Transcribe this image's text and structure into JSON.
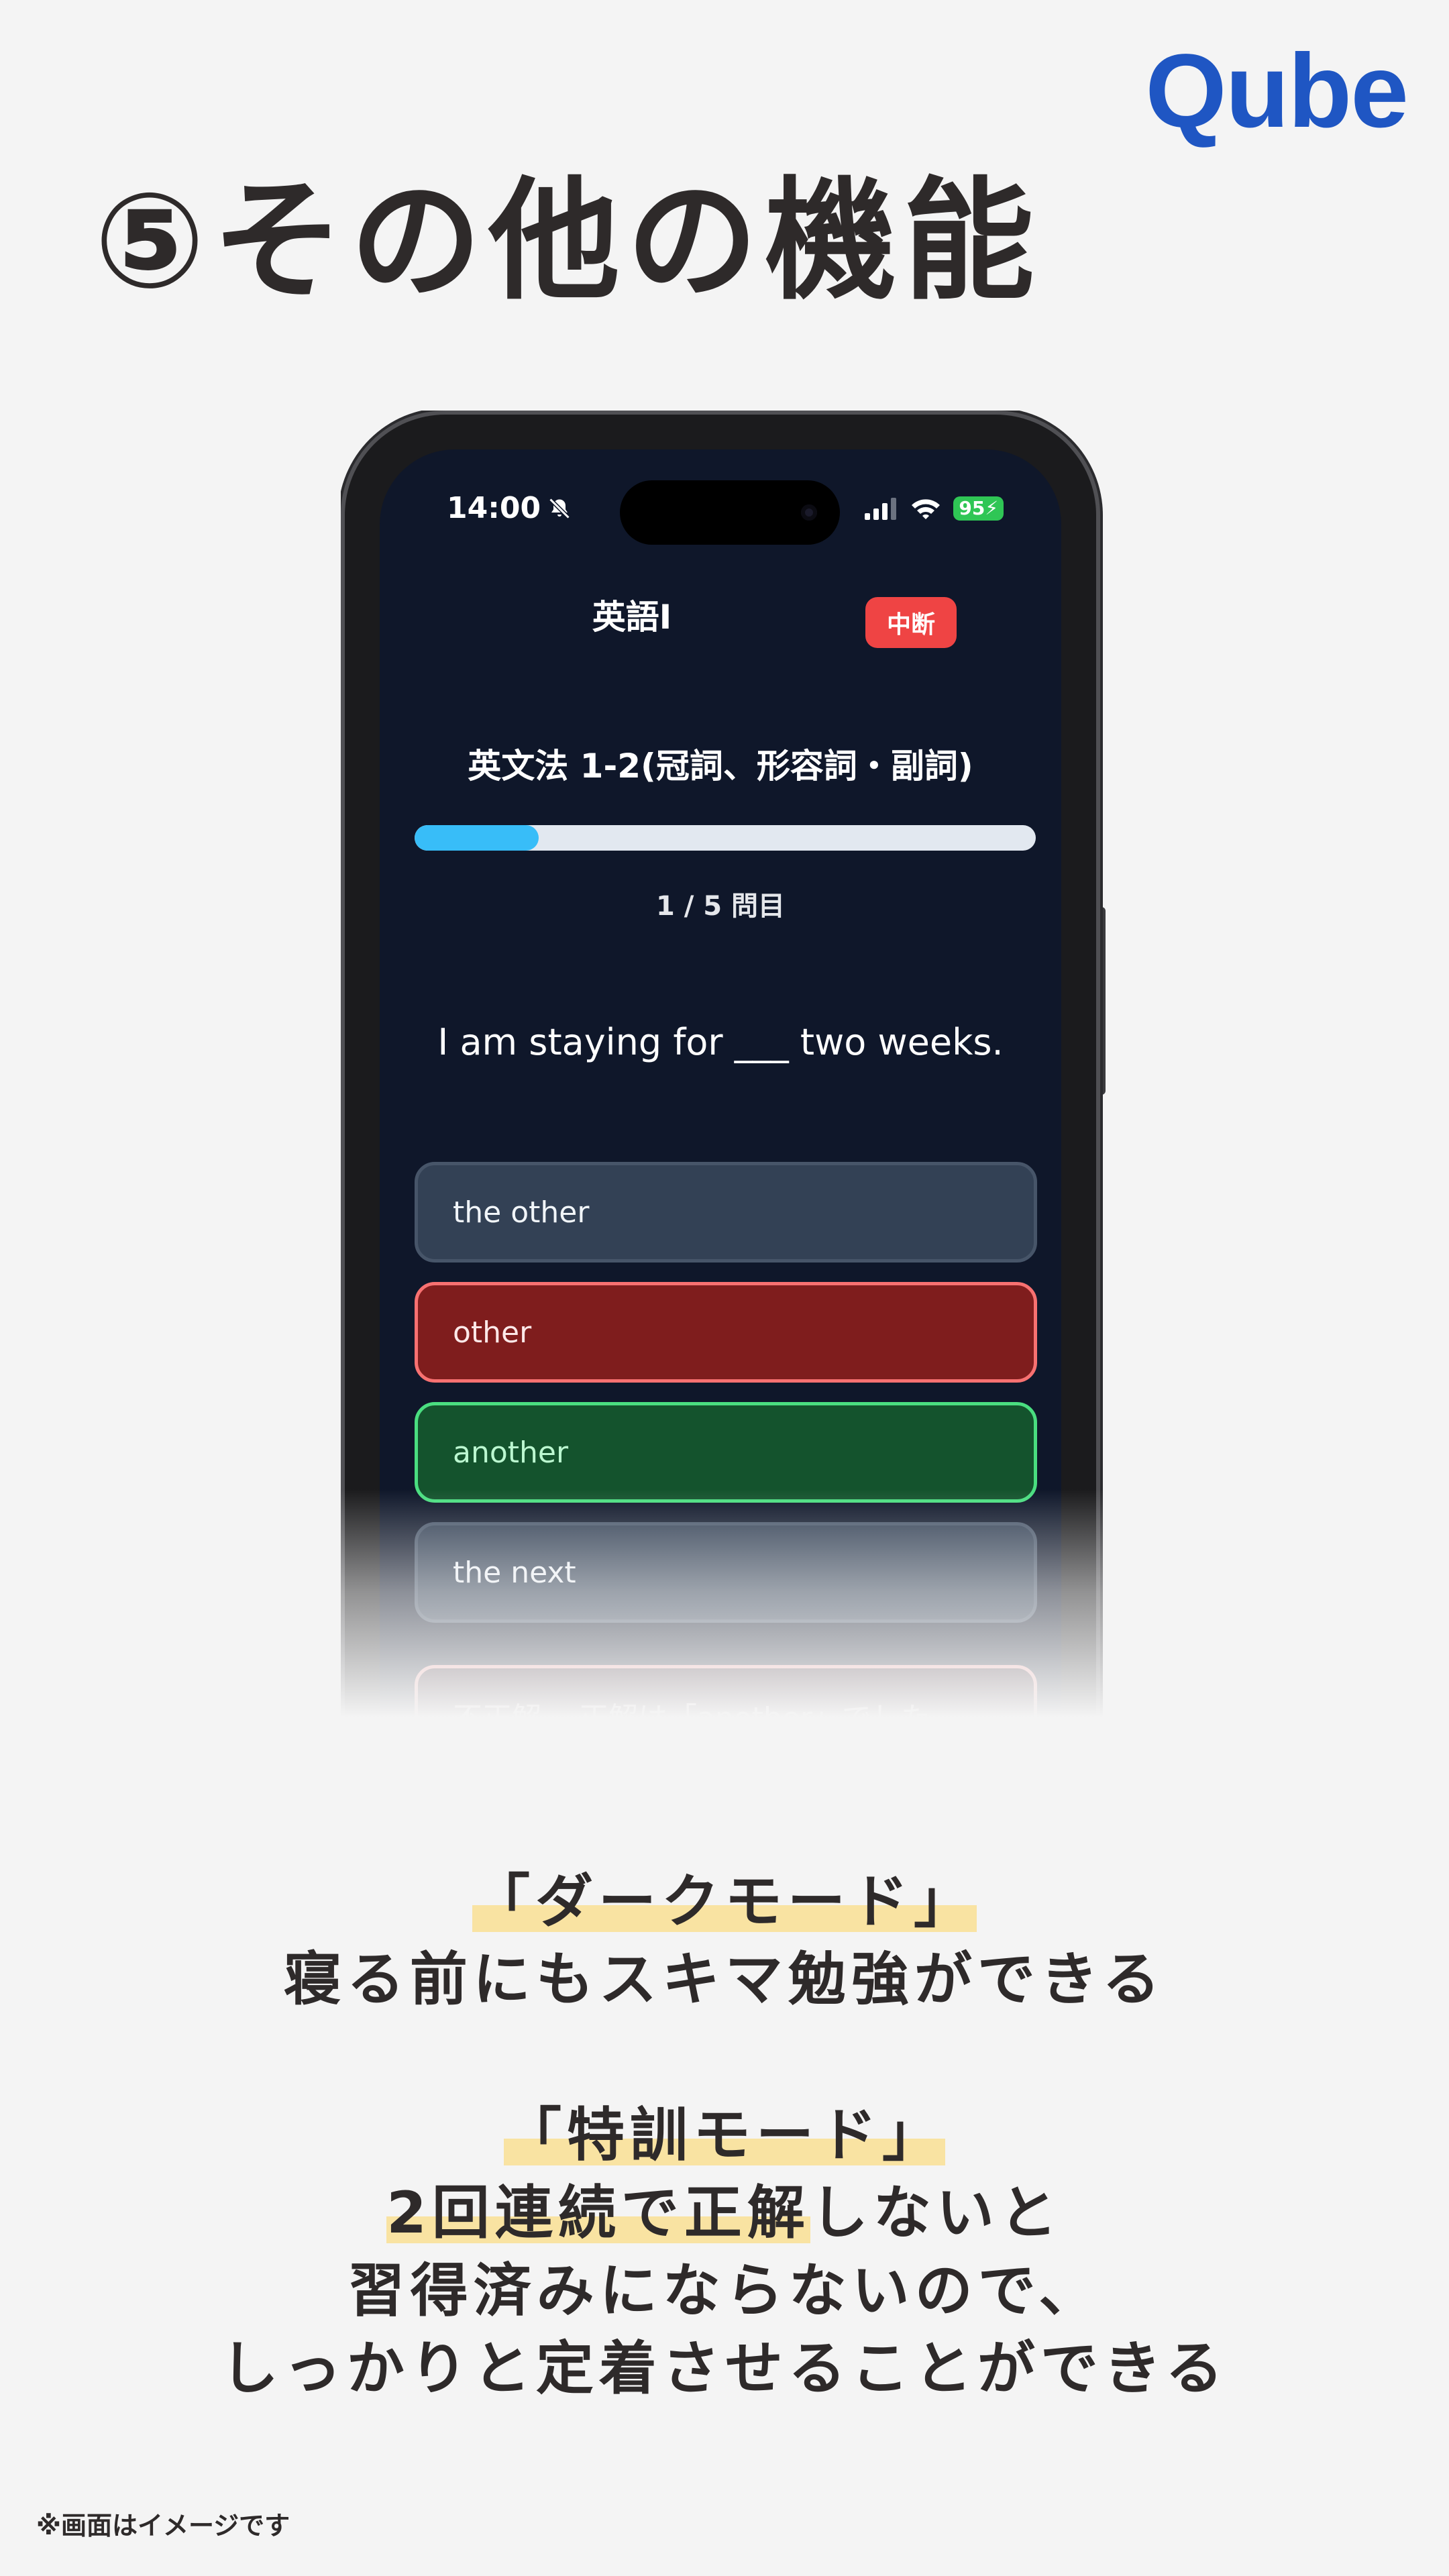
{
  "brand": {
    "logo": "Qube",
    "color": "#1f56c3"
  },
  "page_title": "⑤その他の機能",
  "phone": {
    "status": {
      "time": "14:00",
      "battery": "95"
    },
    "app": {
      "subject": "英語I",
      "pause_label": "中断",
      "quiz_title": "英文法 1-2(冠詞、形容詞・副詞)",
      "progress": {
        "current": 1,
        "total": 5,
        "fraction": 0.2,
        "label": "1 / 5 問目"
      },
      "question": "I am staying for ___ two weeks.",
      "options": [
        {
          "label": "the other",
          "state": "neutral"
        },
        {
          "label": "other",
          "state": "wrong"
        },
        {
          "label": "another",
          "state": "correct"
        },
        {
          "label": "the next",
          "state": "neutral"
        }
      ],
      "feedback": "不正解... 正解は「another」でした"
    },
    "colors": {
      "screen_bg": "#0f172a",
      "progress_fill": "#38bdf8",
      "wrong": "#7f1d1d",
      "correct": "#14532d",
      "pause": "#ef4444"
    }
  },
  "captions": {
    "dark_mode_title": "「ダークモード」",
    "dark_mode_desc": "寝る前にもスキマ勉強ができる",
    "training_title": "「特訓モード」",
    "training_desc_hl": "2回連続で正解",
    "training_desc_rest": "しないと",
    "training_desc_2": "習得済みにならないので、",
    "training_desc_3": "しっかりと定着させることができる",
    "highlight_color": "#f9e3a2"
  },
  "footnote": "※画面はイメージです"
}
